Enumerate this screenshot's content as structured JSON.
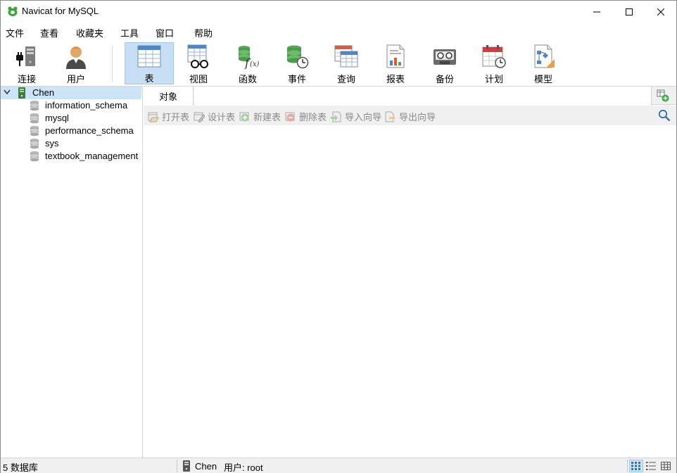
{
  "window": {
    "title": "Navicat for MySQL"
  },
  "menu": {
    "items": [
      "文件",
      "查看",
      "收藏夹",
      "工具",
      "窗口",
      "帮助"
    ]
  },
  "toolbar": {
    "buttons": [
      {
        "label": "连接",
        "icon": "connection-plug-icon"
      },
      {
        "label": "用户",
        "icon": "user-icon"
      },
      {
        "label": "表",
        "icon": "table-icon",
        "active": true
      },
      {
        "label": "视图",
        "icon": "view-glasses-icon"
      },
      {
        "label": "函数",
        "icon": "function-icon"
      },
      {
        "label": "事件",
        "icon": "event-clock-icon"
      },
      {
        "label": "查询",
        "icon": "query-icon"
      },
      {
        "label": "报表",
        "icon": "report-icon"
      },
      {
        "label": "备份",
        "icon": "backup-tape-icon"
      },
      {
        "label": "计划",
        "icon": "schedule-calendar-icon"
      },
      {
        "label": "模型",
        "icon": "model-icon"
      }
    ]
  },
  "tree": {
    "connection": "Chen",
    "databases": [
      "information_schema",
      "mysql",
      "performance_schema",
      "sys",
      "textbook_management"
    ]
  },
  "content": {
    "tab_label": "对象",
    "actions": [
      "打开表",
      "设计表",
      "新建表",
      "删除表",
      "导入向导",
      "导出向导"
    ]
  },
  "status": {
    "db_count": "5 数据库",
    "connection": "Chen",
    "user": "用户: root"
  },
  "colors": {
    "accent": "#c6dff5",
    "selected": "#cce4f7",
    "chrome": "#f0f0f0"
  }
}
